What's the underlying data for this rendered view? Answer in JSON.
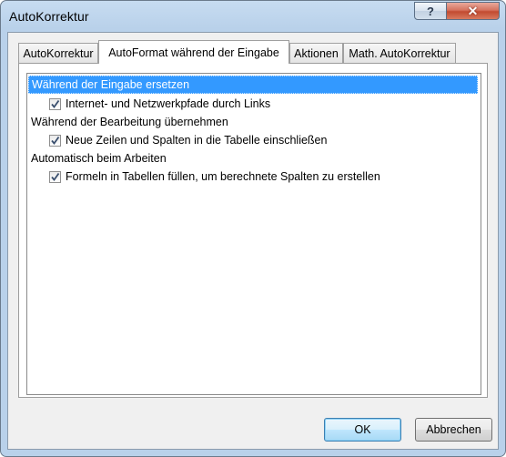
{
  "window": {
    "title": "AutoKorrektur",
    "help_glyph": "?",
    "close_glyph": "✕"
  },
  "tabs": [
    {
      "label": "AutoKorrektur",
      "active": false
    },
    {
      "label": "AutoFormat während der Eingabe",
      "active": true
    },
    {
      "label": "Aktionen",
      "active": false
    },
    {
      "label": "Math. AutoKorrektur",
      "active": false
    }
  ],
  "options": {
    "groups": [
      {
        "header": "Während der Eingabe ersetzen",
        "selected": true,
        "items": [
          {
            "label": "Internet- und Netzwerkpfade durch Links",
            "checked": true
          }
        ]
      },
      {
        "header": "Während der Bearbeitung übernehmen",
        "selected": false,
        "items": [
          {
            "label": "Neue Zeilen und Spalten in die Tabelle einschließen",
            "checked": true
          }
        ]
      },
      {
        "header": "Automatisch beim Arbeiten",
        "selected": false,
        "items": [
          {
            "label": "Formeln in Tabellen füllen, um berechnete Spalten zu erstellen",
            "checked": true
          }
        ]
      }
    ]
  },
  "buttons": {
    "ok": "OK",
    "cancel": "Abbrechen"
  },
  "colors": {
    "selection": "#3399ff",
    "title_gradient_top": "#c7dcf1",
    "close_button": "#c24a30"
  }
}
